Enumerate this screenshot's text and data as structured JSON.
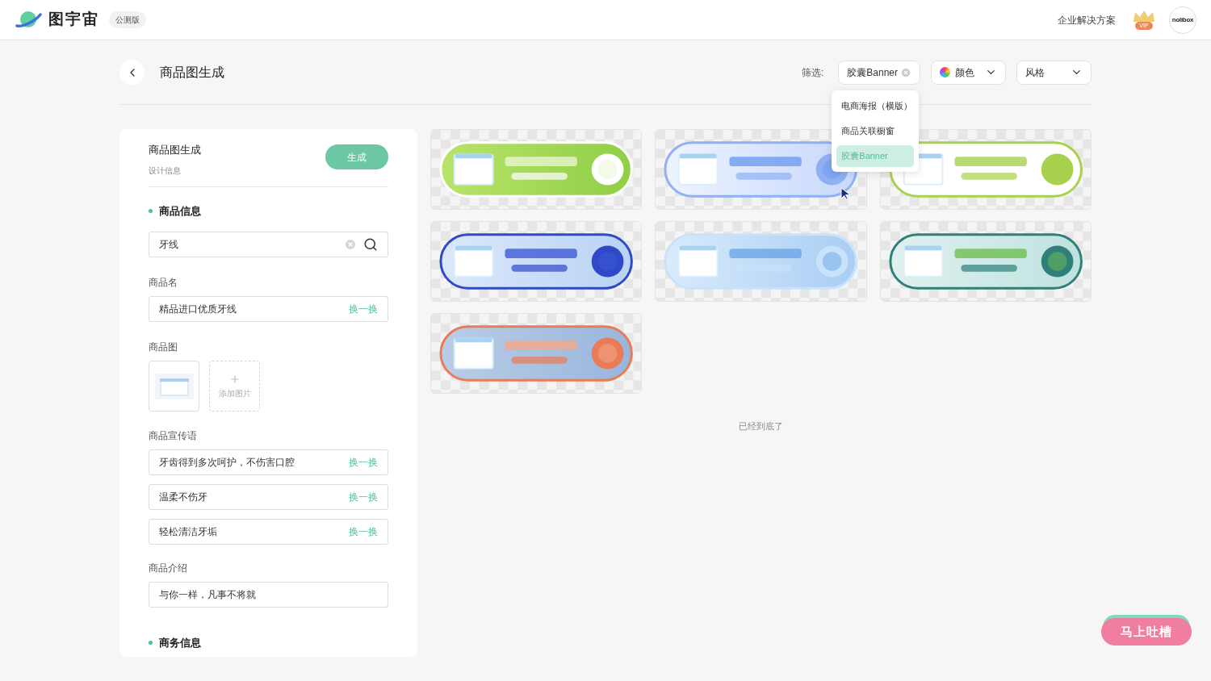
{
  "header": {
    "brand": "图宇宙",
    "badge": "公测版",
    "links": [
      "企业解决方案"
    ],
    "vip": "VIP",
    "avatar": "nolibox"
  },
  "page": {
    "title": "商品图生成"
  },
  "filters": {
    "label": "筛选:",
    "chips": [
      {
        "kind": "tag",
        "label": "胶囊Banner"
      },
      {
        "kind": "color",
        "label": "颜色"
      },
      {
        "kind": "select",
        "label": "风格"
      }
    ],
    "menu": [
      {
        "label": "电商海报（横版）",
        "selected": false
      },
      {
        "label": "商品关联橱窗",
        "selected": false
      },
      {
        "label": "胶囊Banner",
        "selected": true
      }
    ]
  },
  "form": {
    "title": "商品图生成",
    "subtitle": "设计信息",
    "generate": "生成",
    "sections": [
      {
        "title": "商品信息"
      },
      {
        "title": "商务信息"
      }
    ],
    "search": {
      "value": "牙线"
    },
    "name": {
      "label": "商品名",
      "value": "精品进口优质牙线",
      "action": "换一换"
    },
    "image": {
      "label": "商品图",
      "add": "添加图片"
    },
    "slogans": {
      "label": "商品宣传语",
      "items": [
        {
          "value": "牙齿得到多次呵护，不伤害口腔",
          "action": "换一换"
        },
        {
          "value": "温柔不伤牙",
          "action": "换一换"
        },
        {
          "value": "轻松清洁牙垢",
          "action": "换一换"
        }
      ]
    },
    "intro": {
      "label": "商品介绍",
      "value": "与你一样，凡事不将就"
    }
  },
  "end_note": "已经到底了",
  "feedback": "马上吐槽"
}
